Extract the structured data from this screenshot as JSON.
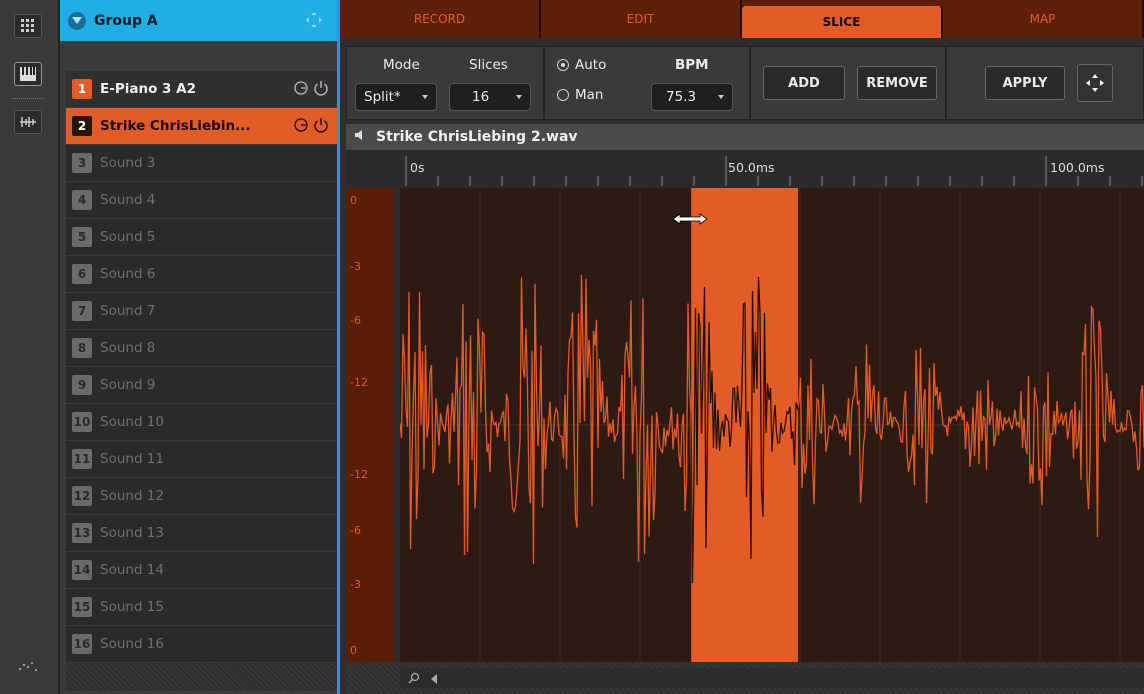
{
  "sidebar_icons": [
    "pad-grid-icon",
    "keyboard-icon",
    "slice-view-icon",
    "level-meter-icon"
  ],
  "group": {
    "title": "Group A",
    "sounds": [
      {
        "num": "1",
        "label": "E-Piano 3 A2",
        "state": "selected"
      },
      {
        "num": "2",
        "label": "Strike ChrisLiebin...",
        "state": "focused"
      },
      {
        "num": "3",
        "label": "Sound 3",
        "state": "empty"
      },
      {
        "num": "4",
        "label": "Sound 4",
        "state": "empty"
      },
      {
        "num": "5",
        "label": "Sound 5",
        "state": "empty"
      },
      {
        "num": "6",
        "label": "Sound 6",
        "state": "empty"
      },
      {
        "num": "7",
        "label": "Sound 7",
        "state": "empty"
      },
      {
        "num": "8",
        "label": "Sound 8",
        "state": "empty"
      },
      {
        "num": "9",
        "label": "Sound 9",
        "state": "empty"
      },
      {
        "num": "10",
        "label": "Sound 10",
        "state": "empty"
      },
      {
        "num": "11",
        "label": "Sound 11",
        "state": "empty"
      },
      {
        "num": "12",
        "label": "Sound 12",
        "state": "empty"
      },
      {
        "num": "13",
        "label": "Sound 13",
        "state": "empty"
      },
      {
        "num": "14",
        "label": "Sound 14",
        "state": "empty"
      },
      {
        "num": "15",
        "label": "Sound 15",
        "state": "empty"
      },
      {
        "num": "16",
        "label": "Sound 16",
        "state": "empty"
      }
    ]
  },
  "tabs": [
    {
      "label": "RECORD",
      "active": false
    },
    {
      "label": "EDIT",
      "active": false
    },
    {
      "label": "SLICE",
      "active": true
    },
    {
      "label": "MAP",
      "active": false
    }
  ],
  "toolbar": {
    "mode_label": "Mode",
    "mode_value": "Split*",
    "slices_label": "Slices",
    "slices_value": "16",
    "auto_label": "Auto",
    "man_label": "Man",
    "detect_mode": "Auto",
    "bpm_label": "BPM",
    "bpm_value": "75.3",
    "add_label": "ADD",
    "remove_label": "REMOVE",
    "apply_label": "APPLY"
  },
  "sample": {
    "file_name": "Strike ChrisLiebing 2.wav",
    "timeline_labels": [
      "0s",
      "50.0ms",
      "100.0ms"
    ],
    "db_labels": [
      "0",
      "-3",
      "-6",
      "-12",
      "-12",
      "-6",
      "-3",
      "0"
    ],
    "selected_slice_ms": [
      45.5,
      62.2
    ]
  },
  "colors": {
    "accent": "#e35b26",
    "group": "#1faee6",
    "waveform": "#e35b26",
    "wave_bg": "#2e1a14"
  }
}
